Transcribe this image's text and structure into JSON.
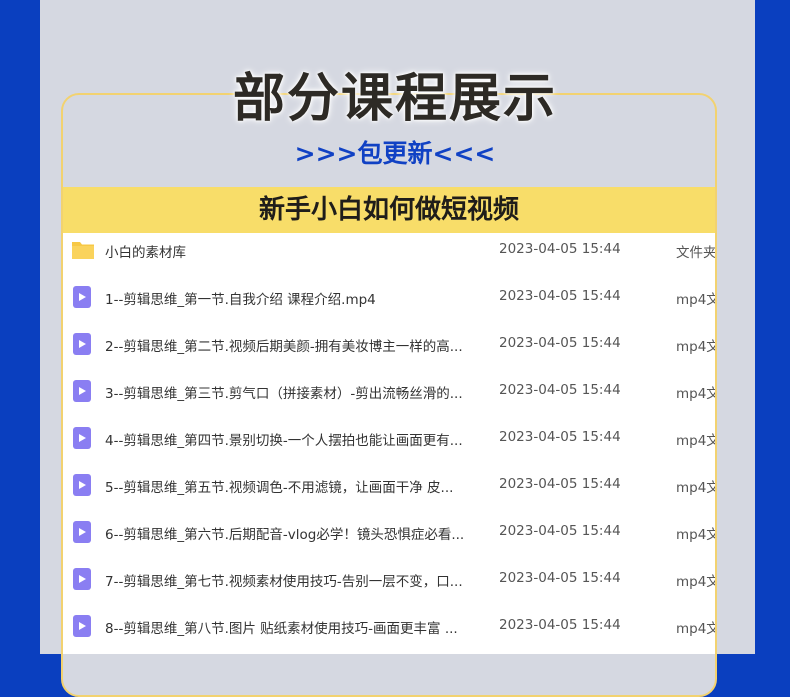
{
  "title": "部分课程展示",
  "subtitle": ">>>包更新<<<",
  "section_heading": "新手小白如何做短视频",
  "colors": {
    "background_blue": "#0a3fbf",
    "panel": "#d5d8e1",
    "heading_bar": "#f8dd69",
    "card_border": "#f2d270",
    "subtitle": "#1041c4",
    "folder_icon": "#f7c845",
    "video_icon": "#8a7ef2"
  },
  "files": [
    {
      "icon": "folder-icon",
      "name": "小白的素材库",
      "date": "2023-04-05 15:44",
      "type": "文件夹"
    },
    {
      "icon": "video-file-icon",
      "name": "1--剪辑思维_第一节.自我介绍 课程介绍.mp4",
      "date": "2023-04-05 15:44",
      "type": "mp4文"
    },
    {
      "icon": "video-file-icon",
      "name": "2--剪辑思维_第二节.视频后期美颜-拥有美妆博主一样的高...",
      "date": "2023-04-05 15:44",
      "type": "mp4文"
    },
    {
      "icon": "video-file-icon",
      "name": "3--剪辑思维_第三节.剪气口（拼接素材）-剪出流畅丝滑的...",
      "date": "2023-04-05 15:44",
      "type": "mp4文"
    },
    {
      "icon": "video-file-icon",
      "name": "4--剪辑思维_第四节.景别切换-一个人摆拍也能让画面更有...",
      "date": "2023-04-05 15:44",
      "type": "mp4文"
    },
    {
      "icon": "video-file-icon",
      "name": "5--剪辑思维_第五节.视频调色-不用滤镜，让画面干净 皮...",
      "date": "2023-04-05 15:44",
      "type": "mp4文"
    },
    {
      "icon": "video-file-icon",
      "name": "6--剪辑思维_第六节.后期配音-vlog必学！镜头恐惧症必看...",
      "date": "2023-04-05 15:44",
      "type": "mp4文"
    },
    {
      "icon": "video-file-icon",
      "name": "7--剪辑思维_第七节.视频素材使用技巧-告别一层不变，口...",
      "date": "2023-04-05 15:44",
      "type": "mp4文"
    },
    {
      "icon": "video-file-icon",
      "name": "8--剪辑思维_第八节.图片 贴纸素材使用技巧-画面更丰富 ...",
      "date": "2023-04-05 15:44",
      "type": "mp4文"
    }
  ]
}
